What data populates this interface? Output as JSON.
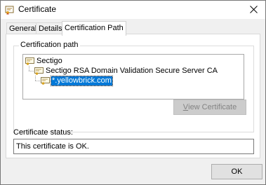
{
  "window": {
    "title": "Certificate",
    "icon": "certificate-icon",
    "close_icon": "close-icon"
  },
  "tabs": [
    {
      "label": "General",
      "active": false
    },
    {
      "label": "Details",
      "active": false
    },
    {
      "label": "Certification Path",
      "active": true
    }
  ],
  "certification_path": {
    "group_label": "Certification path",
    "nodes": [
      {
        "label": "Sectigo",
        "level": 0,
        "selected": false,
        "icon": "certificate-icon"
      },
      {
        "label": "Sectigo RSA Domain Validation Secure Server CA",
        "level": 1,
        "selected": false,
        "icon": "certificate-icon"
      },
      {
        "label": "*.yellowbrick.com",
        "level": 2,
        "selected": true,
        "icon": "certificate-icon"
      }
    ],
    "view_button_label": "View Certificate",
    "view_button_accel": "V",
    "view_button_rest": "iew Certificate",
    "view_button_enabled": false
  },
  "status": {
    "label": "Certificate status:",
    "text": "This certificate is OK."
  },
  "ok_button_label": "OK",
  "colors": {
    "selection": "#0078d7",
    "dialog_bg": "#f0f0f0"
  }
}
